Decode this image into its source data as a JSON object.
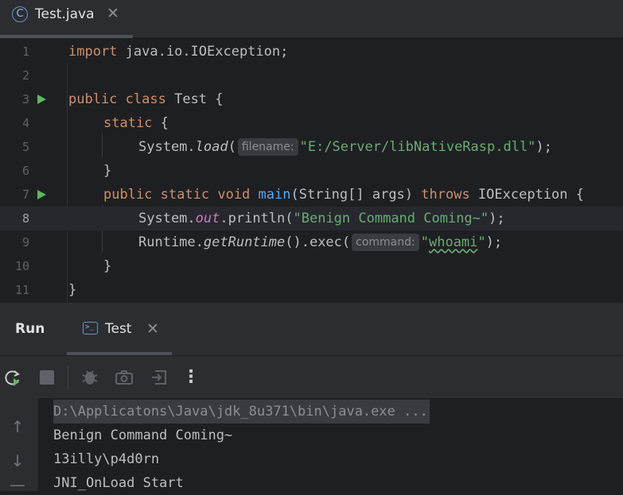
{
  "editor_tab": {
    "icon": "C",
    "label": "Test.java",
    "close": "✕"
  },
  "code": {
    "line_numbers": [
      "1",
      "2",
      "3",
      "4",
      "5",
      "6",
      "7",
      "8",
      "9",
      "10",
      "11"
    ],
    "l1": {
      "kw": "import",
      "rest": " java.io.IOException;"
    },
    "l3": {
      "kw1": "public",
      "kw2": "class",
      "rest": " Test {"
    },
    "l4": {
      "kw": "static",
      "rest": " {"
    },
    "l5": {
      "pre": "System.",
      "method": "load",
      "paren": "(",
      "hint": "filename:",
      "str": "\"E:/Server/libNativeRasp.dll\"",
      "post": ");"
    },
    "l6": {
      "text": "}"
    },
    "l7": {
      "kw1": "public",
      "kw2": "static",
      "kw3": "void",
      "fn": "main",
      "mid": "(String[] args) ",
      "kw4": "throws",
      "rest": " IOException {"
    },
    "l8": {
      "pre": "System.",
      "field": "out",
      "mid": ".println(",
      "str": "\"Benign Command Coming~\"",
      "post": ");"
    },
    "l9": {
      "pre": "Runtime.",
      "method": "getRuntime",
      "mid": "().exec(",
      "hint": "command:",
      "str_q1": "\"",
      "str_word": "whoami",
      "str_q2": "\"",
      "post": ");"
    },
    "l10": {
      "text": "}"
    },
    "l11": {
      "text": "}"
    }
  },
  "run_panel": {
    "title": "Run",
    "tab_label": "Test",
    "tab_close": "✕"
  },
  "console": {
    "command": "D:\\Applicatons\\Java\\jdk_8u371\\bin\\java.exe ...",
    "output": [
      "Benign Command Coming~",
      "13illy\\p4d0rn",
      "JNI_OnLoad Start"
    ]
  },
  "colors": {
    "background": "#1e1f22",
    "panel": "#2b2d30",
    "keyword": "#cf8e6d",
    "function": "#56a8f5",
    "string": "#6aab73",
    "run_icon": "#5fb760"
  }
}
